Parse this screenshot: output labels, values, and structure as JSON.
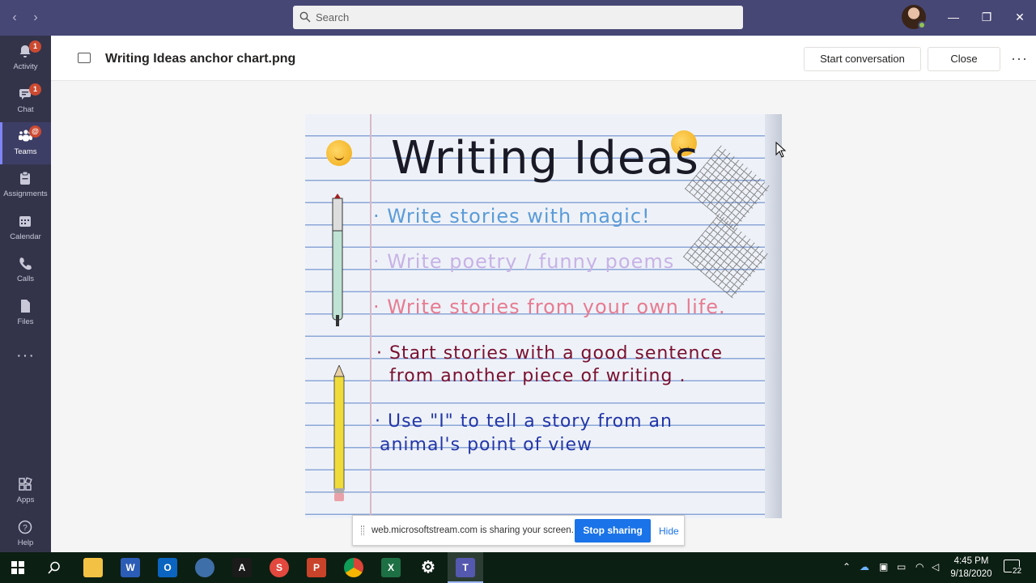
{
  "search": {
    "placeholder": "Search"
  },
  "rail": [
    {
      "label": "Activity",
      "badge": "1"
    },
    {
      "label": "Chat",
      "badge": "1"
    },
    {
      "label": "Teams",
      "badge": "@"
    },
    {
      "label": "Assignments"
    },
    {
      "label": "Calendar"
    },
    {
      "label": "Calls"
    },
    {
      "label": "Files"
    },
    {
      "label": "Apps"
    },
    {
      "label": "Help"
    }
  ],
  "header": {
    "file_title": "Writing Ideas anchor chart.png",
    "start_conversation": "Start conversation",
    "close": "Close",
    "more": "···"
  },
  "anchor_chart": {
    "title": "Writing Ideas",
    "ideas": [
      {
        "text": "· Write stories  with magic!",
        "color": "#5b9bd8"
      },
      {
        "text": "· Write poetry / funny poems",
        "color": "#c8b2e6"
      },
      {
        "text": "· Write stories  from  your own life.",
        "color": "#e77b91"
      },
      {
        "text": "· Start stories  with a good sentence",
        "color": "#7a1030"
      },
      {
        "text": "from  another  piece  of  writing .",
        "color": "#7a1030"
      },
      {
        "text": "· Use \"I\" to tell a story from an",
        "color": "#2436a8"
      },
      {
        "text": "animal's point of view",
        "color": "#2436a8"
      }
    ]
  },
  "share_bar": {
    "message": "web.microsoftstream.com is sharing your screen.",
    "stop": "Stop sharing",
    "hide": "Hide"
  },
  "taskbar": {
    "time": "4:45 PM",
    "date": "9/18/2020",
    "notifications": "22"
  },
  "colors": {
    "titlebar": "#464775",
    "rail": "#33344a",
    "accent": "#6264a7",
    "share_blue": "#1a73e8"
  }
}
